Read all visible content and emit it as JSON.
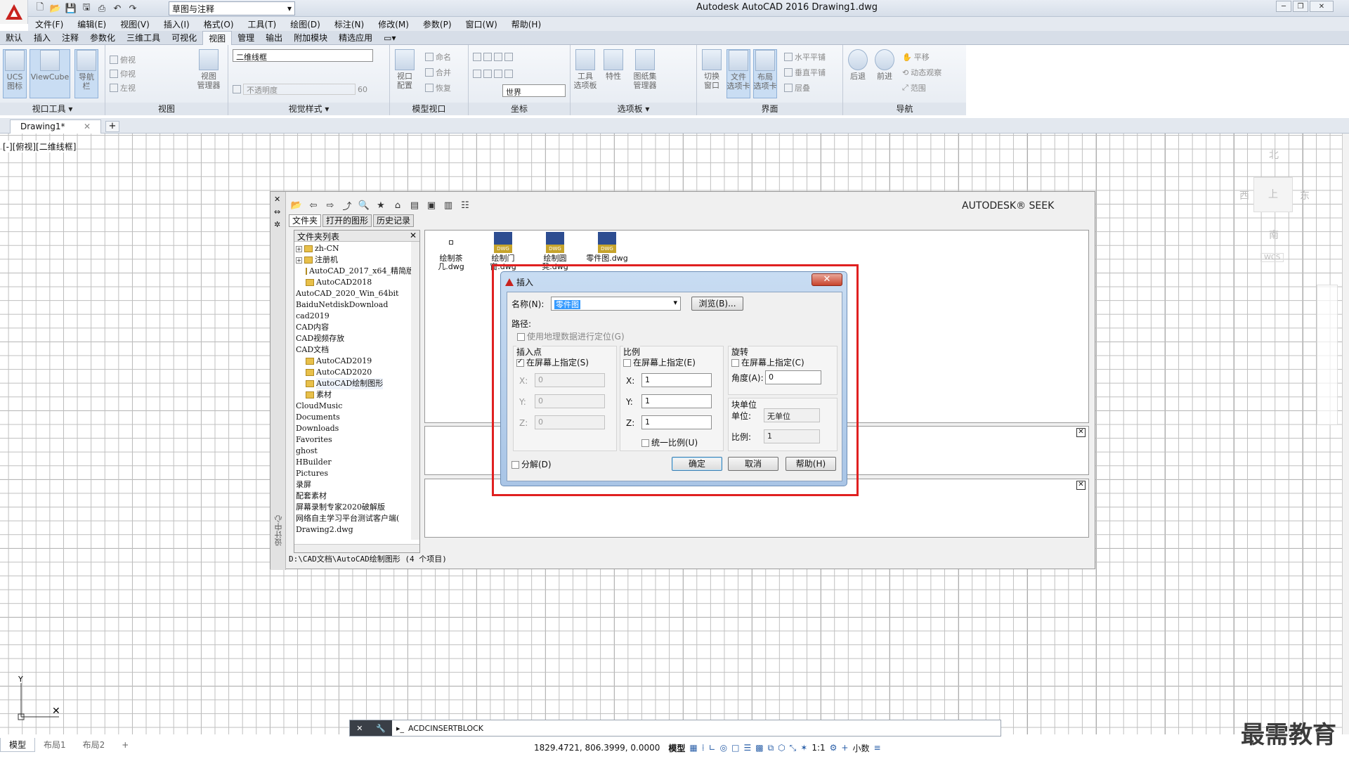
{
  "window": {
    "title": "Autodesk AutoCAD 2016    Drawing1.dwg",
    "workspace": "草图与注释"
  },
  "menus": [
    "文件(F)",
    "编辑(E)",
    "视图(V)",
    "插入(I)",
    "格式(O)",
    "工具(T)",
    "绘图(D)",
    "标注(N)",
    "修改(M)",
    "参数(P)",
    "窗口(W)",
    "帮助(H)"
  ],
  "ribbon_tabs": [
    "默认",
    "插入",
    "注释",
    "参数化",
    "三维工具",
    "可视化",
    "视图",
    "管理",
    "输出",
    "附加模块",
    "精选应用"
  ],
  "ribbon_active_tab": "视图",
  "ribbon": {
    "viewport_tools": {
      "label": "视口工具",
      "buttons": [
        "UCS\n图标",
        "ViewCube",
        "导航栏"
      ]
    },
    "views": {
      "label": "视图",
      "items": [
        "俯视",
        "仰视",
        "左视"
      ],
      "manager": "视图\n管理器"
    },
    "visual_styles": {
      "label": "视觉样式",
      "current": "二维线框",
      "opacity_label": "不透明度",
      "opacity": "60"
    },
    "model_viewports": {
      "label": "模型视口",
      "btn": "视口\n配置",
      "items": [
        "命名",
        "合并",
        "恢复"
      ]
    },
    "coordinates": {
      "label": "坐标",
      "world": "世界"
    },
    "palettes": {
      "label": "选项板",
      "items": [
        "工具\n选项板",
        "特性",
        "图纸集\n管理器"
      ]
    },
    "interface": {
      "label": "界面",
      "items": [
        "切换\n窗口",
        "文件\n选项卡",
        "布局\n选项卡"
      ],
      "tiles": [
        "水平平铺",
        "垂直平铺",
        "层叠"
      ]
    },
    "navigate": {
      "label": "导航",
      "items": [
        "后退",
        "前进"
      ],
      "pan": "平移",
      "orbit": "动态观察",
      "extent": "范围"
    }
  },
  "doc_tab": "Drawing1*",
  "view_label": "[-][俯视][二维线框]",
  "viewcube": {
    "n": "北",
    "s": "南",
    "e": "东",
    "w": "西",
    "top": "上",
    "wcs": "WCS"
  },
  "design_center": {
    "seek": "AUTODESK® SEEK",
    "tabs": [
      "文件夹",
      "打开的图形",
      "历史记录"
    ],
    "folder_header": "文件夹列表",
    "folders": [
      {
        "name": "zh-CN",
        "icon": true,
        "plus": true
      },
      {
        "name": "注册机",
        "icon": true,
        "plus": true
      },
      {
        "name": "AutoCAD_2017_x64_精简版",
        "icon": true
      },
      {
        "name": "AutoCAD2018",
        "icon": true
      },
      {
        "name": "AutoCAD_2020_Win_64bit"
      },
      {
        "name": "BaiduNetdiskDownload"
      },
      {
        "name": "cad2019"
      },
      {
        "name": "CAD内容"
      },
      {
        "name": "CAD视频存放"
      },
      {
        "name": "CAD文档"
      },
      {
        "name": "AutoCAD2019",
        "icon": true
      },
      {
        "name": "AutoCAD2020",
        "icon": true
      },
      {
        "name": "AutoCAD绘制图形",
        "icon": true,
        "selected": true
      },
      {
        "name": "素材",
        "icon": true
      },
      {
        "name": "CloudMusic"
      },
      {
        "name": "Documents"
      },
      {
        "name": "Downloads"
      },
      {
        "name": "Favorites"
      },
      {
        "name": "ghost"
      },
      {
        "name": "HBuilder"
      },
      {
        "name": "Pictures"
      },
      {
        "name": "录屏"
      },
      {
        "name": "配套素材"
      },
      {
        "name": "屏幕录制专家2020破解版"
      },
      {
        "name": "网络自主学习平台测试客户端("
      },
      {
        "name": "Drawing2.dwg"
      }
    ],
    "files": [
      "绘制茶几.dwg",
      "绘制门窗.dwg",
      "绘制圆凳.dwg",
      "零件图.dwg"
    ],
    "side_label": "设计中心",
    "status": "D:\\CAD文档\\AutoCAD绘制图形 (4 个项目)"
  },
  "insert_dialog": {
    "title": "插入",
    "name_label": "名称(N):",
    "name_value": "零件图",
    "browse": "浏览(B)...",
    "path_label": "路径:",
    "geo_label": "使用地理数据进行定位(G)",
    "insertion": {
      "label": "插入点",
      "onscreen": "在屏幕上指定(S)",
      "x": "0",
      "y": "0",
      "z": "0"
    },
    "scale": {
      "label": "比例",
      "onscreen": "在屏幕上指定(E)",
      "x": "1",
      "y": "1",
      "z": "1",
      "uniform": "统一比例(U)"
    },
    "rotation": {
      "label": "旋转",
      "onscreen": "在屏幕上指定(C)",
      "angle_label": "角度(A):",
      "angle": "0"
    },
    "block_unit": {
      "label": "块单位",
      "unit_label": "单位:",
      "unit": "无单位",
      "factor_label": "比例:",
      "factor": "1"
    },
    "explode": "分解(D)",
    "ok": "确定",
    "cancel": "取消",
    "help": "帮助(H)"
  },
  "command": {
    "text": "ACDCINSERTBLOCK"
  },
  "layouts": [
    "模型",
    "布局1",
    "布局2"
  ],
  "status": {
    "coords": "1829.4721, 806.3999, 0.0000",
    "model": "模型",
    "scale": "1:1",
    "units": "小数"
  },
  "watermark": "最需教育"
}
